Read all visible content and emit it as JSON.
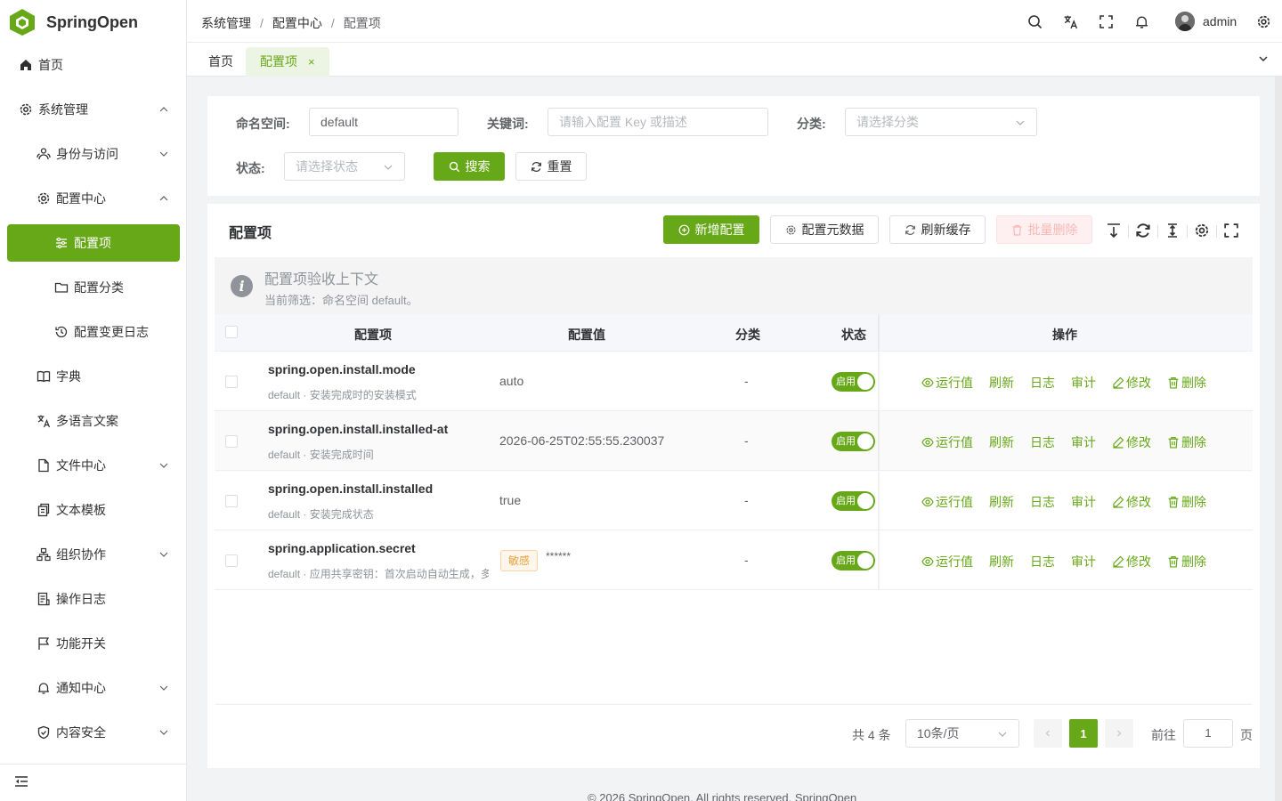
{
  "app": {
    "name": "SpringOpen",
    "brand_color": "#67a818"
  },
  "sidebar": {
    "items": [
      {
        "label": "首页",
        "icon": "home-icon"
      },
      {
        "label": "系统管理",
        "icon": "gear-icon",
        "expanded": true
      },
      {
        "label": "身份与访问",
        "icon": "users-icon",
        "expanded": false
      },
      {
        "label": "配置中心",
        "icon": "gear-icon",
        "expanded": true
      },
      {
        "label": "配置项",
        "icon": "sliders-icon",
        "active": true
      },
      {
        "label": "配置分类",
        "icon": "folder-icon"
      },
      {
        "label": "配置变更日志",
        "icon": "history-icon"
      },
      {
        "label": "字典",
        "icon": "book-icon"
      },
      {
        "label": "多语言文案",
        "icon": "translate-icon"
      },
      {
        "label": "文件中心",
        "icon": "file-icon",
        "expanded": false
      },
      {
        "label": "文本模板",
        "icon": "copy-icon"
      },
      {
        "label": "组织协作",
        "icon": "org-icon",
        "expanded": false
      },
      {
        "label": "操作日志",
        "icon": "log-icon"
      },
      {
        "label": "功能开关",
        "icon": "flag-icon"
      },
      {
        "label": "通知中心",
        "icon": "bell-icon",
        "expanded": false
      },
      {
        "label": "内容安全",
        "icon": "shield-icon",
        "expanded": false
      }
    ]
  },
  "header": {
    "breadcrumb": [
      "系统管理",
      "配置中心",
      "配置项"
    ],
    "breadcrumb_sep": "/",
    "username": "admin"
  },
  "tabs": [
    {
      "label": "首页"
    },
    {
      "label": "配置项",
      "close": "×"
    }
  ],
  "filter": {
    "namespace_label": "命名空间:",
    "namespace_value": "default",
    "keyword_label": "关键词:",
    "keyword_placeholder": "请输入配置 Key 或描述",
    "category_label": "分类:",
    "category_placeholder": "请选择分类",
    "status_label": "状态:",
    "status_placeholder": "请选择状态",
    "search_label": "搜索",
    "reset_label": "重置"
  },
  "panel": {
    "title": "配置项",
    "add_label": "新增配置",
    "meta_label": "配置元数据",
    "refresh_cache_label": "刷新缓存",
    "batch_delete_label": "批量删除"
  },
  "alert": {
    "title": "配置项验收上下文",
    "desc": "当前筛选：命名空间 default。"
  },
  "table": {
    "columns": [
      "配置项",
      "配置值",
      "分类",
      "状态",
      "操作"
    ],
    "rows": [
      {
        "key": "spring.open.install.mode",
        "desc": "default · 安装完成时的安装模式",
        "value": "auto",
        "category": "-",
        "status": "启用"
      },
      {
        "key": "spring.open.install.installed-at",
        "desc": "default · 安装完成时间",
        "value": "2026-06-25T02:55:55.230037",
        "category": "-",
        "status": "启用"
      },
      {
        "key": "spring.open.install.installed",
        "desc": "default · 安装完成状态",
        "value": "true",
        "category": "-",
        "status": "启用"
      },
      {
        "key": "spring.application.secret",
        "desc": "default · 应用共享密钥：首次启动自动生成，多",
        "value": "******",
        "tag": "敏感",
        "category": "-",
        "status": "启用"
      }
    ],
    "actions": [
      "运行值",
      "刷新",
      "日志",
      "审计",
      "修改",
      "删除"
    ]
  },
  "pagination": {
    "total_text": "共 4 条",
    "page_size": "10条/页",
    "current_page": "1",
    "goto_label": "前往",
    "goto_value": "1",
    "page_suffix": "页"
  },
  "footer": {
    "text": "© 2026 SpringOpen. All rights reserved. SpringOpen"
  }
}
